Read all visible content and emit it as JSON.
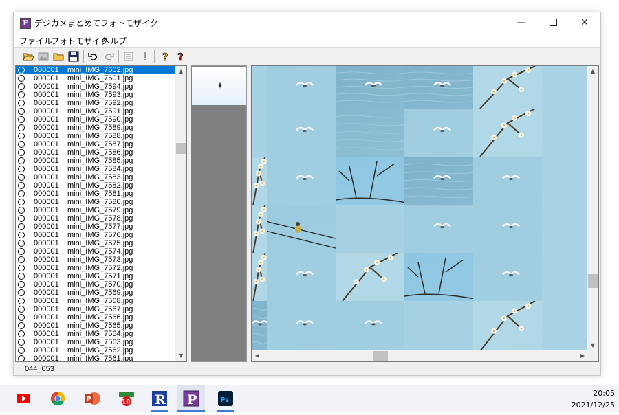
{
  "window": {
    "title": "デジカメまとめてフォトモザイク",
    "icon_letter": "F",
    "controls": {
      "minimize": "—",
      "close": "✕"
    }
  },
  "menu": [
    "ファイル",
    "フォトモザイク",
    "ヘルプ"
  ],
  "toolbar_icons": [
    "open-folder-icon",
    "image-icon",
    "folder-icon",
    "save-icon",
    "undo-icon",
    "redo-icon",
    "list-icon",
    "exclamation-icon",
    "help-icon",
    "context-help-icon"
  ],
  "file_list": {
    "items": [
      {
        "num": "000001",
        "name": "mini_IMG_7602.jpg",
        "selected": true
      },
      {
        "num": "000001",
        "name": "mini_IMG_7601.jpg"
      },
      {
        "num": "000001",
        "name": "mini_IMG_7594.jpg"
      },
      {
        "num": "000001",
        "name": "mini_IMG_7593.jpg"
      },
      {
        "num": "000001",
        "name": "mini_IMG_7592.jpg"
      },
      {
        "num": "000001",
        "name": "mini_IMG_7591.jpg"
      },
      {
        "num": "000001",
        "name": "mini_IMG_7590.jpg"
      },
      {
        "num": "000001",
        "name": "mini_IMG_7589.jpg"
      },
      {
        "num": "000001",
        "name": "mini_IMG_7588.jpg"
      },
      {
        "num": "000001",
        "name": "mini_IMG_7587.jpg"
      },
      {
        "num": "000001",
        "name": "mini_IMG_7586.jpg"
      },
      {
        "num": "000001",
        "name": "mini_IMG_7585.jpg"
      },
      {
        "num": "000001",
        "name": "mini_IMG_7584.jpg"
      },
      {
        "num": "000001",
        "name": "mini_IMG_7583.jpg"
      },
      {
        "num": "000001",
        "name": "mini_IMG_7582.jpg"
      },
      {
        "num": "000001",
        "name": "mini_IMG_7581.jpg"
      },
      {
        "num": "000001",
        "name": "mini_IMG_7580.jpg"
      },
      {
        "num": "000001",
        "name": "mini_IMG_7579.jpg"
      },
      {
        "num": "000001",
        "name": "mini_IMG_7578.jpg"
      },
      {
        "num": "000001",
        "name": "mini_IMG_7577.jpg"
      },
      {
        "num": "000001",
        "name": "mini_IMG_7576.jpg"
      },
      {
        "num": "000001",
        "name": "mini_IMG_7575.jpg"
      },
      {
        "num": "000001",
        "name": "mini_IMG_7574.jpg"
      },
      {
        "num": "000001",
        "name": "mini_IMG_7573.jpg"
      },
      {
        "num": "000001",
        "name": "mini_IMG_7572.jpg"
      },
      {
        "num": "000001",
        "name": "mini_IMG_7571.jpg"
      },
      {
        "num": "000001",
        "name": "mini_IMG_7570.jpg"
      },
      {
        "num": "000001",
        "name": "mini_IMG_7569.jpg"
      },
      {
        "num": "000001",
        "name": "mini_IMG_7568.jpg"
      },
      {
        "num": "000001",
        "name": "mini_IMG_7567.jpg"
      },
      {
        "num": "000001",
        "name": "mini_IMG_7566.jpg"
      },
      {
        "num": "000001",
        "name": "mini_IMG_7565.jpg"
      },
      {
        "num": "000001",
        "name": "mini_IMG_7564.jpg"
      },
      {
        "num": "000001",
        "name": "mini_IMG_7563.jpg"
      },
      {
        "num": "000001",
        "name": "mini_IMG_7562.jpg"
      },
      {
        "num": "000001",
        "name": "mini_IMG_7561.jpg"
      }
    ]
  },
  "mosaic": {
    "tiles": [
      {
        "row": 0,
        "col": 0,
        "kind": "sky"
      },
      {
        "row": 0,
        "col": 1,
        "kind": "sky-gull"
      },
      {
        "row": 0,
        "col": 2,
        "kind": "sea-gull"
      },
      {
        "row": 0,
        "col": 3,
        "kind": "sea-gull"
      },
      {
        "row": 0,
        "col": 4,
        "kind": "plum"
      },
      {
        "row": 1,
        "col": 0,
        "kind": "sky"
      },
      {
        "row": 1,
        "col": 1,
        "kind": "sky-gull"
      },
      {
        "row": 1,
        "col": 2,
        "kind": "sea"
      },
      {
        "row": 1,
        "col": 3,
        "kind": "sky-gull"
      },
      {
        "row": 1,
        "col": 4,
        "kind": "plum"
      },
      {
        "row": 2,
        "col": 0,
        "kind": "plum"
      },
      {
        "row": 2,
        "col": 1,
        "kind": "sky-gull"
      },
      {
        "row": 2,
        "col": 2,
        "kind": "branch"
      },
      {
        "row": 2,
        "col": 3,
        "kind": "sea-gull"
      },
      {
        "row": 2,
        "col": 4,
        "kind": "sky-gull"
      },
      {
        "row": 3,
        "col": 0,
        "kind": "plum"
      },
      {
        "row": 3,
        "col": 1,
        "kind": "wire-bird"
      },
      {
        "row": 3,
        "col": 2,
        "kind": "sky"
      },
      {
        "row": 3,
        "col": 3,
        "kind": "sky-gull"
      },
      {
        "row": 3,
        "col": 4,
        "kind": "sky-gull"
      },
      {
        "row": 4,
        "col": 0,
        "kind": "plum"
      },
      {
        "row": 4,
        "col": 1,
        "kind": "sky-gull"
      },
      {
        "row": 4,
        "col": 2,
        "kind": "plum"
      },
      {
        "row": 4,
        "col": 3,
        "kind": "branch"
      },
      {
        "row": 4,
        "col": 4,
        "kind": "sky-gull"
      },
      {
        "row": 5,
        "col": 0,
        "kind": "sea-gull"
      },
      {
        "row": 5,
        "col": 1,
        "kind": "sky-gull"
      },
      {
        "row": 5,
        "col": 2,
        "kind": "sky-gull"
      },
      {
        "row": 5,
        "col": 3,
        "kind": "sky"
      },
      {
        "row": 5,
        "col": 4,
        "kind": "plum"
      }
    ]
  },
  "status": "044_053",
  "taskbar": {
    "apps": [
      {
        "name": "youtube-icon"
      },
      {
        "name": "chrome-icon"
      },
      {
        "name": "powerpoint-icon"
      },
      {
        "name": "security-icon",
        "label": "10+"
      },
      {
        "name": "r-app-icon",
        "label": "R"
      },
      {
        "name": "p-app-icon",
        "label": "P"
      },
      {
        "name": "photoshop-icon",
        "label": "Ps"
      }
    ],
    "time": "20:05",
    "date": "2021/12/25"
  }
}
